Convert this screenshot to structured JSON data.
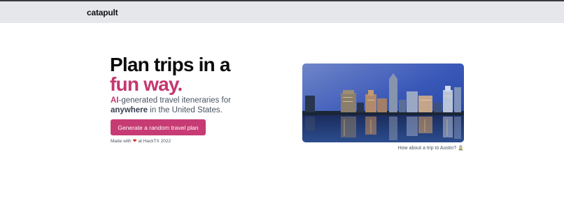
{
  "nav": {
    "brand": "catapult"
  },
  "hero": {
    "title_line1": "Plan trips in a",
    "title_line2": "fun way.",
    "subtitle_ai": "AI",
    "subtitle_part1": "-generated travel iteneraries for",
    "subtitle_anywhere": "anywhere",
    "subtitle_part2": " in the United States.",
    "cta_label": "Generate a random travel plan",
    "made_with_prefix": "Made with",
    "made_with_suffix": "at HackTX 2022"
  },
  "showcase": {
    "caption": "How about a trip to Austin?",
    "caption_icon": "🚊"
  },
  "colors": {
    "accent": "#c4376f",
    "button": "#c73b74",
    "topbar": "#e5e7eb"
  },
  "icons": {
    "heart": "heart-icon",
    "train": "train-icon"
  }
}
